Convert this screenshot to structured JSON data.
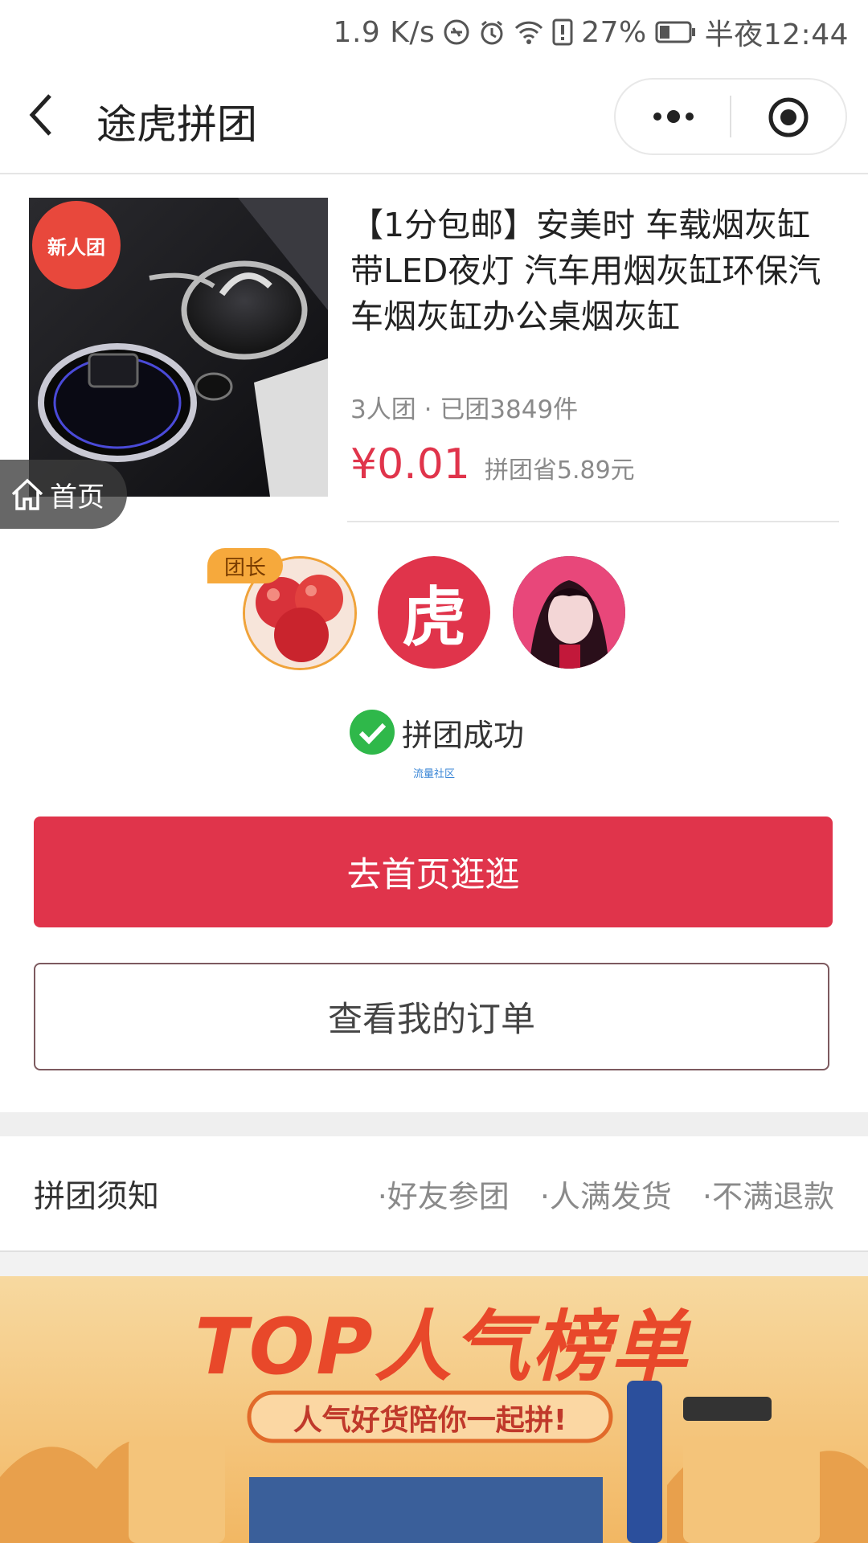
{
  "status_bar": {
    "speed": "1.9 K/s",
    "battery": "27%",
    "time": "半夜12:44"
  },
  "nav": {
    "title": "途虎拼团"
  },
  "product": {
    "badge": "新人团",
    "title": "【1分包邮】安美时 车载烟灰缸带LED夜灯 汽车用烟灰缸环保汽车烟灰缸办公桌烟灰缸",
    "group_info": "3人团 · 已团3849件",
    "price": "¥0.01",
    "save": "拼团省5.89元"
  },
  "home_float": {
    "label": "首页"
  },
  "members": {
    "leader_tag": "团长",
    "avatar2_char": "虎"
  },
  "status": {
    "label": "拼团成功",
    "watermark": "流量社区"
  },
  "buttons": {
    "primary": "去首页逛逛",
    "secondary": "查看我的订单"
  },
  "notice": {
    "title": "拼团须知",
    "items": [
      "·好友参团",
      "·人满发货",
      "·不满退款"
    ]
  },
  "banner": {
    "headline": "TOP人气榜单",
    "subline": "人气好货陪你一起拼!"
  },
  "colors": {
    "accent": "#e0344b",
    "leader": "#f6a93c",
    "success": "#2fb84a"
  }
}
